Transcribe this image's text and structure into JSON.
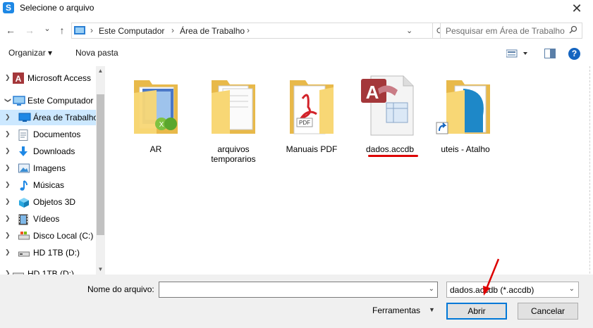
{
  "window": {
    "title": "Selecione o arquivo",
    "app_icon_letter": "S",
    "close_glyph": "✕"
  },
  "nav": {
    "back_glyph": "←",
    "forward_glyph": "→",
    "recent_glyph": "⌄",
    "up_glyph": "↑"
  },
  "address": {
    "segments": [
      "Este Computador",
      "Área de Trabalho"
    ],
    "separator": "›",
    "refresh_glyph": "⟳"
  },
  "search": {
    "placeholder": "Pesquisar em Área de Trabalho",
    "icon": "search-icon"
  },
  "toolbar": {
    "organize_label": "Organizar ▾",
    "new_folder_label": "Nova pasta",
    "help_label": "?"
  },
  "sidebar": {
    "items": [
      {
        "label": "Microsoft Access",
        "icon": "access-icon"
      },
      {
        "label": "Este Computador",
        "icon": "computer-icon"
      },
      {
        "label": "Área de Trabalho",
        "icon": "desktop-icon",
        "selected": true
      },
      {
        "label": "Documentos",
        "icon": "documents-icon"
      },
      {
        "label": "Downloads",
        "icon": "downloads-icon"
      },
      {
        "label": "Imagens",
        "icon": "images-icon"
      },
      {
        "label": "Músicas",
        "icon": "music-icon"
      },
      {
        "label": "Objetos 3D",
        "icon": "objects-3d-icon"
      },
      {
        "label": "Vídeos",
        "icon": "videos-icon"
      },
      {
        "label": "Disco Local (C:)",
        "icon": "drive-icon"
      },
      {
        "label": "HD 1TB (D:)",
        "icon": "drive-icon"
      },
      {
        "label": "HD 1TB (D:)",
        "icon": "drive-icon"
      }
    ]
  },
  "files": {
    "items": [
      {
        "label": "AR",
        "icon": "folder-icon"
      },
      {
        "label": "arquivos temporarios",
        "icon": "folder-icon"
      },
      {
        "label": "Manuais PDF",
        "icon": "folder-pdf-icon"
      },
      {
        "label": "dados.accdb",
        "icon": "access-database-icon"
      },
      {
        "label": "uteis - Atalho",
        "icon": "folder-shortcut-icon"
      }
    ]
  },
  "bottom": {
    "filename_label": "Nome do arquivo:",
    "filename_value": "",
    "filter_value": "dados.accdb (*.accdb)",
    "tools_label": "Ferramentas",
    "open_label": "Abrir",
    "cancel_label": "Cancelar"
  },
  "colors": {
    "accent": "#0078d7",
    "selection": "#cce8ff",
    "annotation_red": "#dd0000",
    "folder_yellow": "#f8d775"
  }
}
